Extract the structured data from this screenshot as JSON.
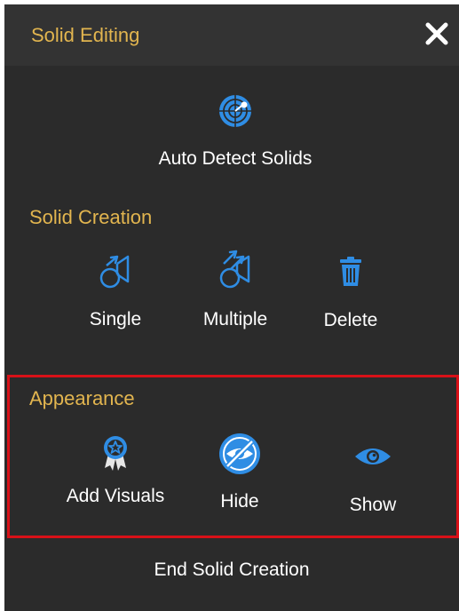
{
  "header": {
    "title": "Solid Editing",
    "close_icon": "close-icon"
  },
  "auto_detect": {
    "label": "Auto Detect Solids",
    "icon": "radar-icon"
  },
  "solid_creation": {
    "title": "Solid Creation",
    "buttons": [
      {
        "label": "Single",
        "icon": "single-solid-icon"
      },
      {
        "label": "Multiple",
        "icon": "multiple-solid-icon"
      },
      {
        "label": "Delete",
        "icon": "trash-icon"
      }
    ]
  },
  "appearance": {
    "title": "Appearance",
    "highlighted": true,
    "buttons": [
      {
        "label": "Add Visuals",
        "icon": "award-badge-icon"
      },
      {
        "label": "Hide",
        "icon": "eye-slash-icon"
      },
      {
        "label": "Show",
        "icon": "eye-icon"
      }
    ]
  },
  "footer": {
    "end_label": "End Solid Creation"
  },
  "colors": {
    "panel_bg": "#2b2b2b",
    "header_bg": "#333333",
    "section_title": "#e2b54f",
    "icon_blue": "#2f8de4",
    "highlight_border": "#d81118",
    "text": "#ffffff"
  }
}
